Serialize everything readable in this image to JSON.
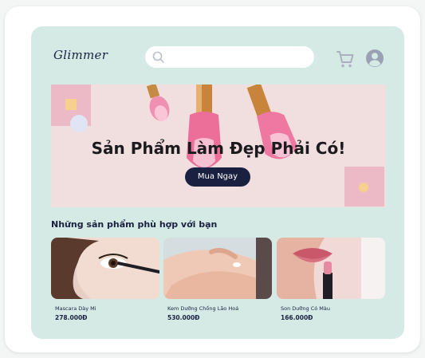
{
  "brand": {
    "logo": "Glimmer"
  },
  "search": {
    "placeholder": ""
  },
  "hero": {
    "title": "Sản Phẩm Làm Đẹp Phải Có!",
    "button_label": "Mua Ngay"
  },
  "section": {
    "title": "Những sản phẩm phù hợp với bạn"
  },
  "products": [
    {
      "name": "Mascara Dày Mi",
      "price": "278.000Đ"
    },
    {
      "name": "Kem Dưỡng Chống Lão Hoá",
      "price": "530.000Đ"
    },
    {
      "name": "Son Dưỡng Có Màu",
      "price": "166.000Đ"
    }
  ],
  "colors": {
    "panel_bg": "#d5eae5",
    "accent_navy": "#1a2140",
    "hero_bg": "#f1dfdf",
    "accent_pink": "#ecb9c7",
    "accent_yellow": "#f6d08c"
  },
  "icons": {
    "search": "search-icon",
    "cart": "cart-icon",
    "account": "user-account-icon"
  }
}
